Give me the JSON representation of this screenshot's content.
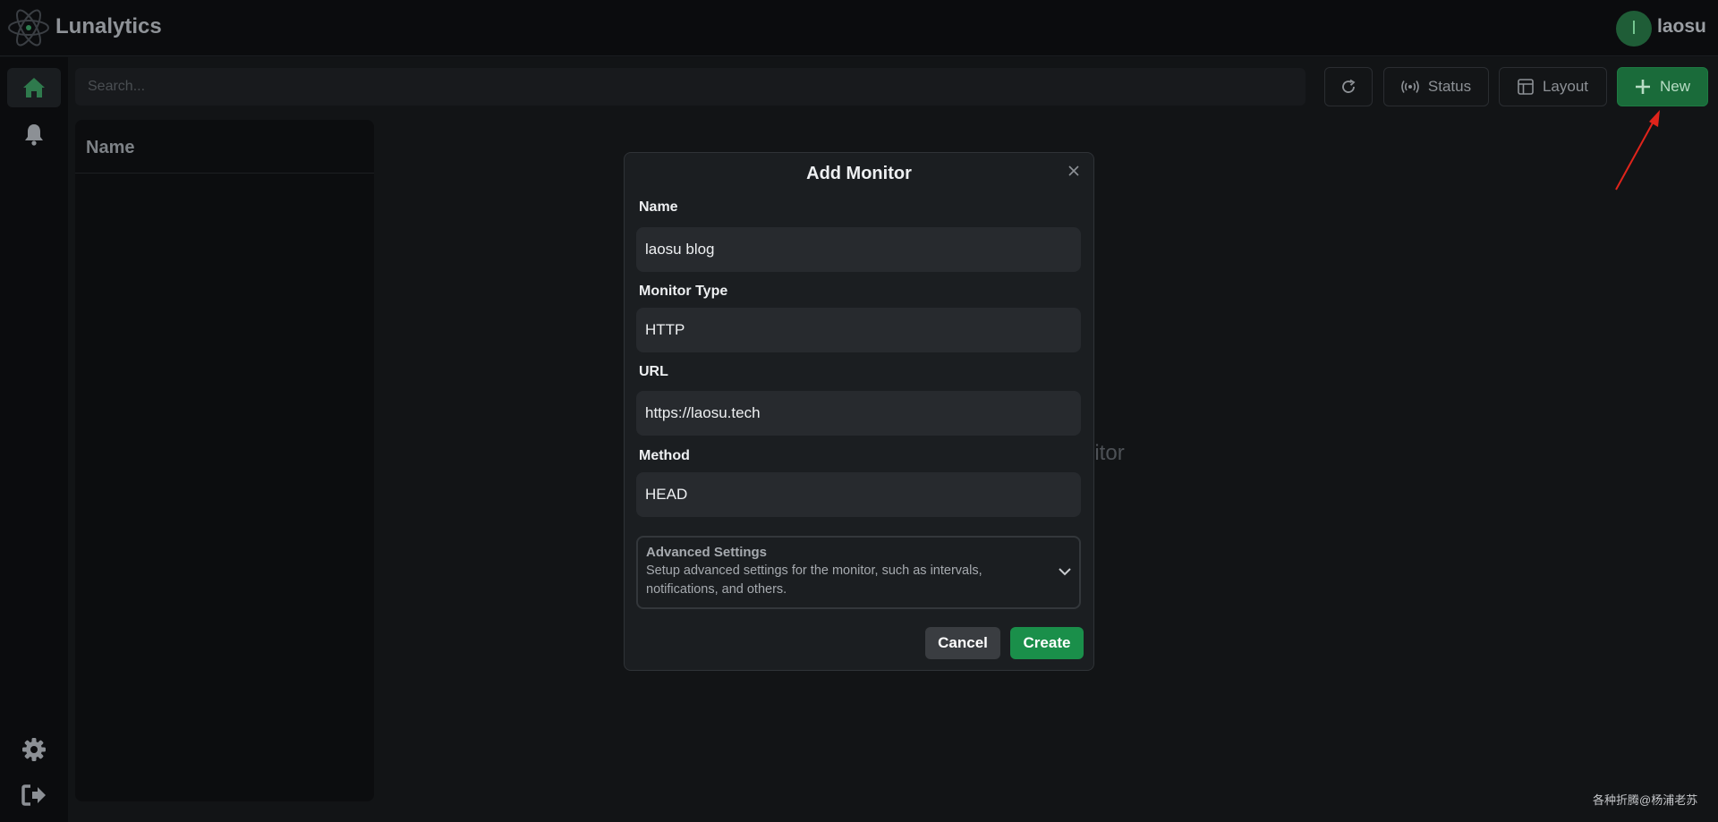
{
  "app": {
    "title": "Lunalytics",
    "logo": "atom-logo"
  },
  "user": {
    "initial": "l",
    "name": "laosu"
  },
  "sidebar": {
    "items": [
      {
        "icon": "home-icon",
        "active": true
      },
      {
        "icon": "bell-icon",
        "active": false
      },
      {
        "icon": "gear-icon",
        "active": false
      },
      {
        "icon": "logout-icon",
        "active": false
      }
    ]
  },
  "toolbar": {
    "search_placeholder": "Search...",
    "refresh_icon": "refresh-icon",
    "status_label": "Status",
    "layout_label": "Layout",
    "new_label": "New"
  },
  "list": {
    "header": "Name"
  },
  "background_text": "nitor",
  "modal": {
    "title": "Add Monitor",
    "name_label": "Name",
    "name_value": "laosu blog",
    "type_label": "Monitor Type",
    "type_value": "HTTP",
    "url_label": "URL",
    "url_value": "https://laosu.tech",
    "method_label": "Method",
    "method_value": "HEAD",
    "advanced_title": "Advanced Settings",
    "advanced_desc": "Setup advanced settings for the monitor, such as intervals, notifications, and others.",
    "cancel_label": "Cancel",
    "create_label": "Create"
  },
  "watermark": "各种折腾@杨浦老苏",
  "colors": {
    "accent": "#1a8f4a",
    "new_button": "#1a6b3a",
    "cancel": "#3a3d41",
    "annotation_arrow": "#e0241b"
  }
}
